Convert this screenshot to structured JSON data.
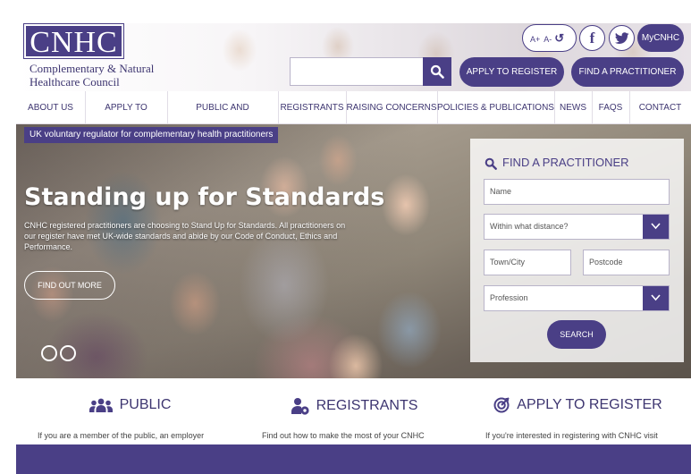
{
  "header": {
    "logo_text": "CNHC",
    "logo_line1": "Complementary & Natural",
    "logo_line2": "Healthcare Council",
    "search": {
      "value": "",
      "placeholder": ""
    },
    "font_controls": {
      "increase": "A+",
      "decrease": "A-",
      "reset": "↺"
    },
    "social": {
      "facebook": "f"
    },
    "mycnhc_label": "MyCNHC",
    "apply_label": "APPLY TO REGISTER",
    "find_label": "FIND A PRACTITIONER"
  },
  "nav": {
    "items": [
      {
        "label": "ABOUT US"
      },
      {
        "label": "APPLY TO REGISTER"
      },
      {
        "label": "PUBLIC AND EMPLOYERS"
      },
      {
        "label": "REGISTRANTS"
      },
      {
        "label": "RAISING CONCERNS"
      },
      {
        "label": "POLICIES & PUBLICATIONS"
      },
      {
        "label": "NEWS"
      },
      {
        "label": "FAQS"
      },
      {
        "label": "CONTACT"
      }
    ]
  },
  "hero": {
    "tag": "UK voluntary regulator for complementary health practitioners",
    "title": "Standing up for Standards",
    "text": "CNHC registered practitioners are choosing to Stand Up for Standards. All practitioners on our register have met UK-wide standards and abide by our Code of Conduct, Ethics and Performance.",
    "cta_label": "FIND OUT MORE"
  },
  "find_panel": {
    "title": "FIND A PRACTITIONER",
    "name_placeholder": "Name",
    "distance_placeholder": "Within what distance?",
    "town_placeholder": "Town/City",
    "postcode_placeholder": "Postcode",
    "profession_placeholder": "Profession",
    "search_label": "SEARCH"
  },
  "cards": [
    {
      "title": "PUBLIC",
      "icon": "people-icon",
      "text": "If you are a member of the public, an employer"
    },
    {
      "title": "REGISTRANTS",
      "icon": "person-gear-icon",
      "text": "Find out how to make the most of your CNHC"
    },
    {
      "title": "APPLY TO REGISTER",
      "icon": "target-icon",
      "text": "If you're interested in registering with CNHC visit"
    }
  ],
  "colors": {
    "brand": "#4a3f86",
    "text": "#3d3570"
  }
}
